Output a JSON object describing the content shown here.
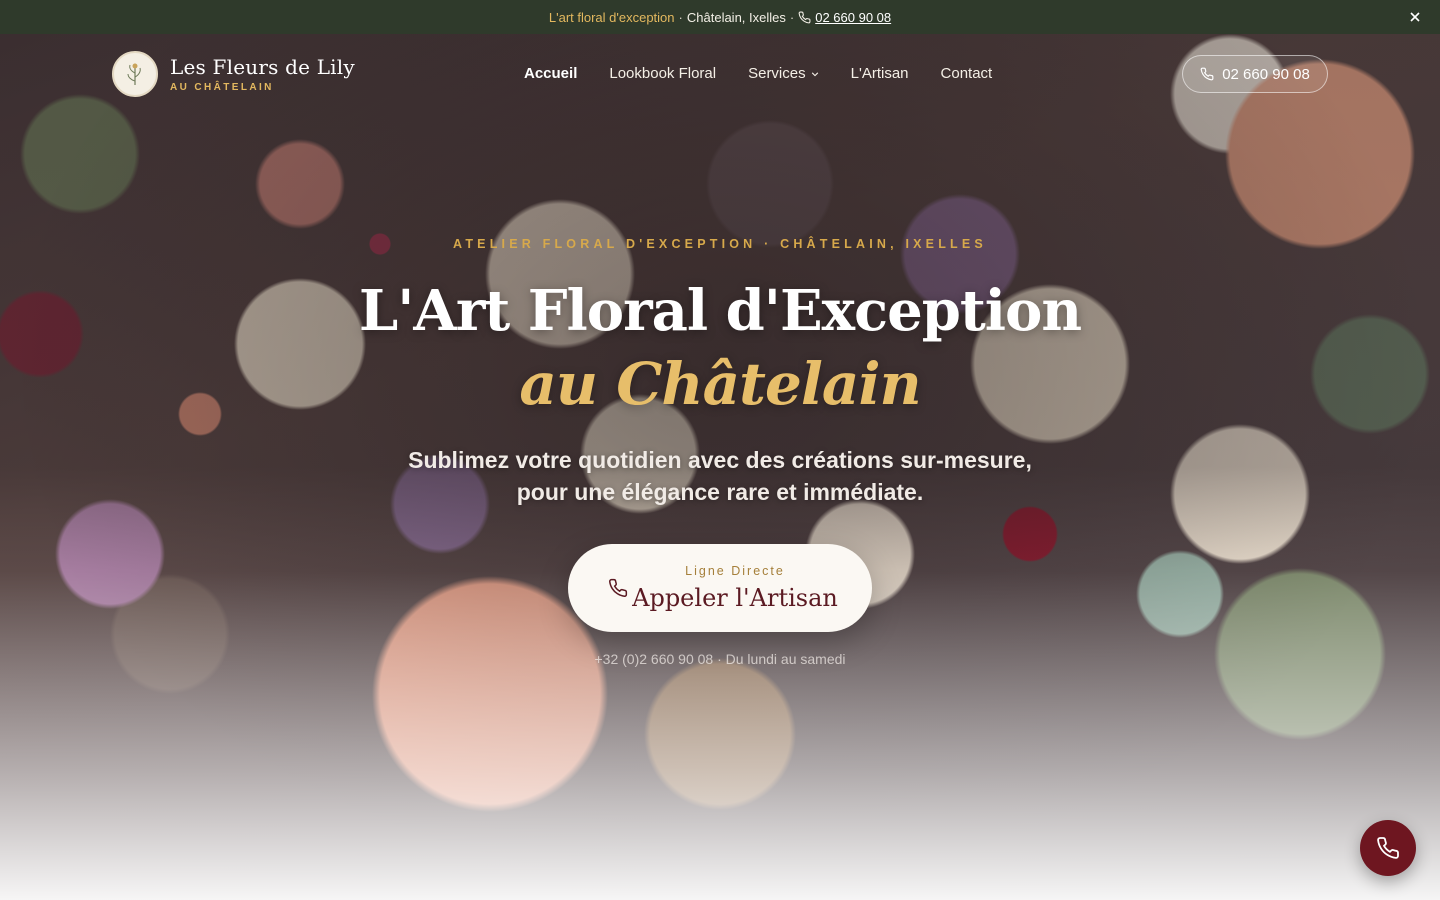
{
  "topbar": {
    "tagline": "L'art floral d'exception",
    "separator": "·",
    "location": "Châtelain, Ixelles",
    "separator2": "·",
    "phone": "02 660 90 08",
    "icons": {
      "phone": "phone-icon",
      "close": "close-icon"
    }
  },
  "brand": {
    "name": "Les Fleurs de Lily",
    "subtitle": "AU CHÂTELAIN"
  },
  "nav": {
    "items": [
      {
        "label": "Accueil",
        "active": true
      },
      {
        "label": "Lookbook Floral"
      },
      {
        "label": "Services",
        "has_dropdown": true
      },
      {
        "label": "L'Artisan"
      },
      {
        "label": "Contact"
      }
    ]
  },
  "header_phone": {
    "label": "02 660 90 08"
  },
  "hero": {
    "eyebrow": "ATELIER FLORAL D'EXCEPTION · CHÂTELAIN, IXELLES",
    "title_line1": "L'Art Floral d'Exception",
    "title_line2": "au Châtelain",
    "subtitle_line1": "Sublimez votre quotidien avec des créations sur-mesure,",
    "subtitle_line2": "pour une élégance rare et immédiate.",
    "cta": {
      "kicker": "Ligne Directe",
      "label": "Appeler l'Artisan"
    },
    "cta_note": "+32 (0)2 660 90 08 · Du lundi au samedi"
  },
  "colors": {
    "topbar_bg": "#2f3a2b",
    "gold": "#e3b85f",
    "burgundy": "#6e1620",
    "cta_text": "#5b1a22"
  }
}
